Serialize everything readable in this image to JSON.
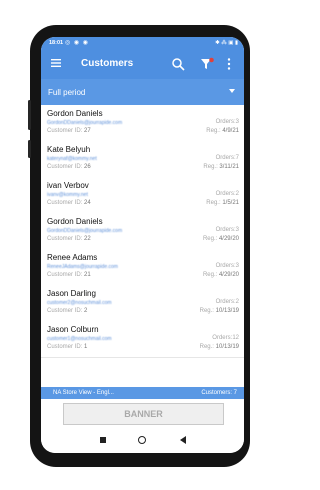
{
  "status_bar": {
    "time": "18:01",
    "left_icons": "◎ ◉ ◉",
    "right_icons": "✱ ⁂ ▣ ▮"
  },
  "app_bar": {
    "title": "Customers"
  },
  "period_filter": {
    "selected": "Full period"
  },
  "customer_labels": {
    "id_prefix": "Customer ID:",
    "orders_prefix": "Orders:",
    "reg_prefix": "Reg.:"
  },
  "customers": [
    {
      "name": "Gordon Daniels",
      "email": "GordonDDaniels@jourrapide.com",
      "id": "27",
      "orders": "3",
      "registered": "4/9/21"
    },
    {
      "name": "Kate Belyuh",
      "email": "katerynaf@kommy.net",
      "id": "26",
      "orders": "7",
      "registered": "3/11/21"
    },
    {
      "name": "ivan Verbov",
      "email": "ivanv@kommy.net",
      "id": "24",
      "orders": "2",
      "registered": "1/5/21"
    },
    {
      "name": "Gordon Daniels",
      "email": "GordonDDaniels@jourrapide.com",
      "id": "22",
      "orders": "3",
      "registered": "4/29/20"
    },
    {
      "name": "Renee Adams",
      "email": "ReneeJAdams@jourrapide.com",
      "id": "21",
      "orders": "3",
      "registered": "4/29/20"
    },
    {
      "name": "Jason Darling",
      "email": "customer2@nosuchmail.com",
      "id": "2",
      "orders": "2",
      "registered": "10/13/19"
    },
    {
      "name": "Jason Colburn",
      "email": "customer1@nosuchmail.com",
      "id": "1",
      "orders": "12",
      "registered": "10/13/19"
    }
  ],
  "footer": {
    "store": "NA Store View - Engl...",
    "count_label": "Customers: 7"
  },
  "banner": {
    "label": "BANNER"
  },
  "colors": {
    "accent": "#4e8fe0",
    "email": "#5b8ed8",
    "muted": "#a8a8a8"
  }
}
